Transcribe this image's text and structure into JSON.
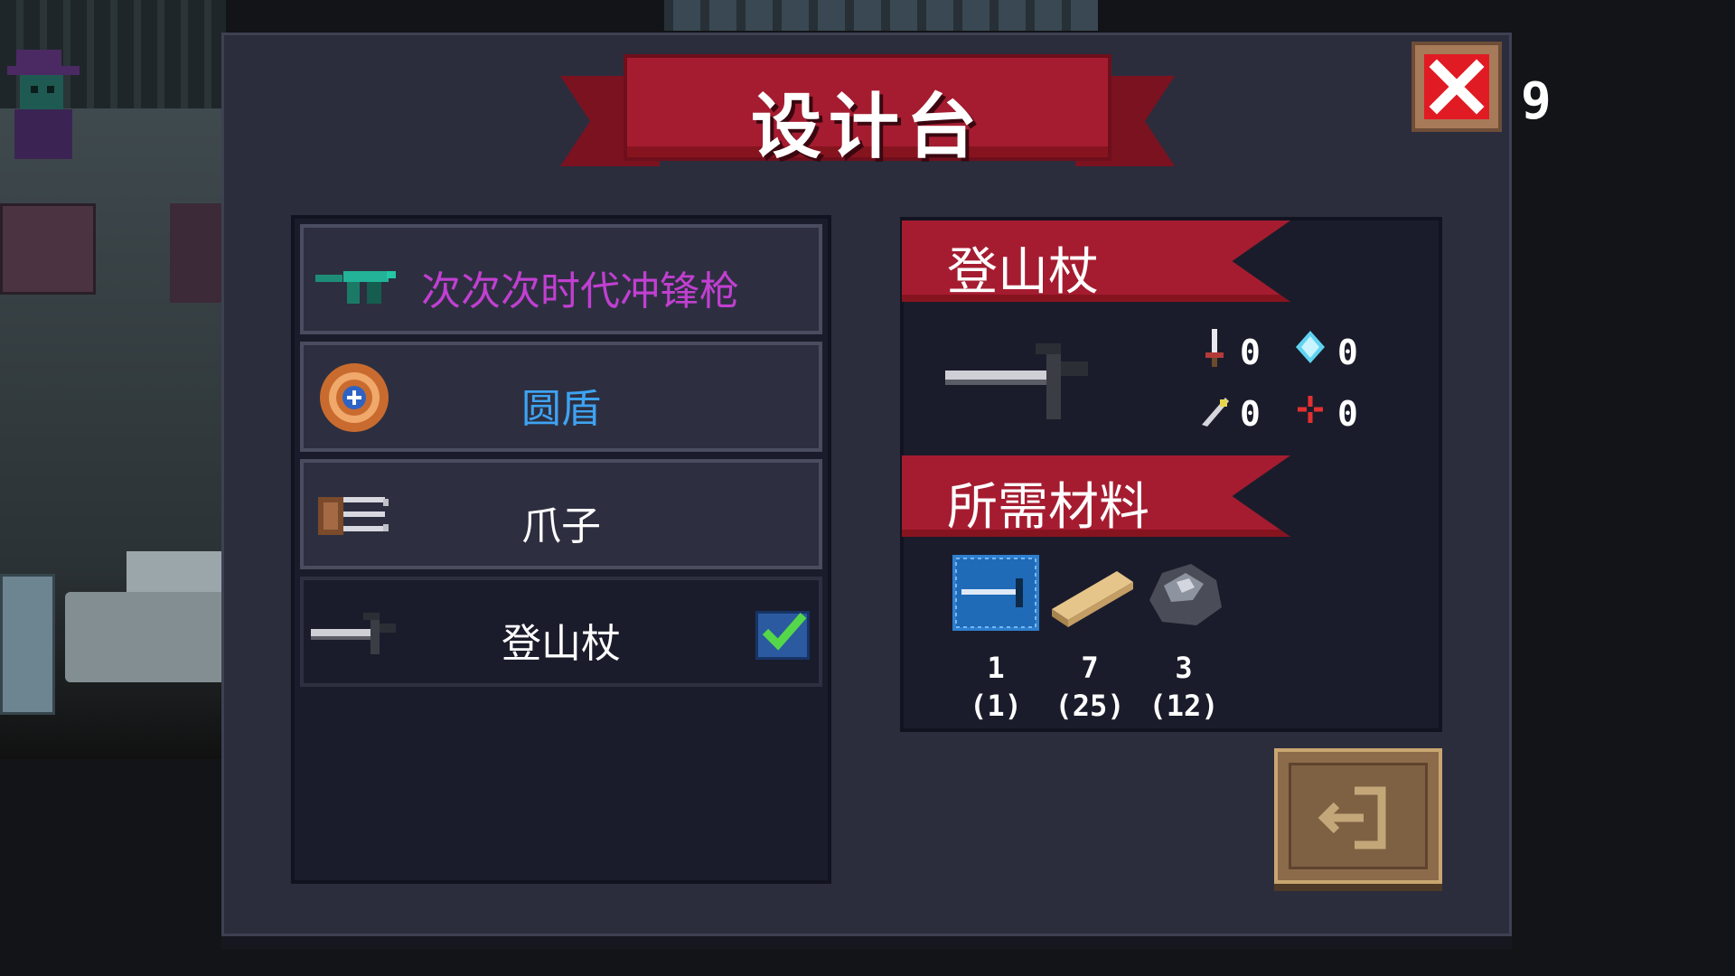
{
  "title": "设计台",
  "close_button": {
    "icon": "close-icon",
    "color": "#e11b23"
  },
  "counter": "9",
  "items": [
    {
      "label": "次次次时代冲锋枪",
      "color": "#c13fd1",
      "icon": "smg-icon",
      "selected": false
    },
    {
      "label": "圆盾",
      "color": "#3ea3f3",
      "icon": "round-shield-icon",
      "selected": false
    },
    {
      "label": "爪子",
      "color": "#ffffff",
      "icon": "claw-icon",
      "selected": false
    },
    {
      "label": "登山杖",
      "color": "#ffffff",
      "icon": "climbing-pick-icon",
      "selected": true
    }
  ],
  "detail": {
    "name": "登山杖",
    "stats": [
      {
        "icon": "dagger-icon",
        "value": "0"
      },
      {
        "icon": "diamond-icon",
        "value": "0"
      },
      {
        "icon": "crit-icon",
        "value": "0"
      },
      {
        "icon": "crosshair-icon",
        "value": "0"
      }
    ],
    "materials_title": "所需材料",
    "materials": [
      {
        "icon": "blueprint-icon",
        "count": "1",
        "owned": "(1)"
      },
      {
        "icon": "wood-plank-icon",
        "count": "7",
        "owned": "(25)"
      },
      {
        "icon": "iron-ore-icon",
        "count": "3",
        "owned": "(12)"
      }
    ]
  },
  "craft_button": {
    "icon": "exit-door-icon"
  }
}
